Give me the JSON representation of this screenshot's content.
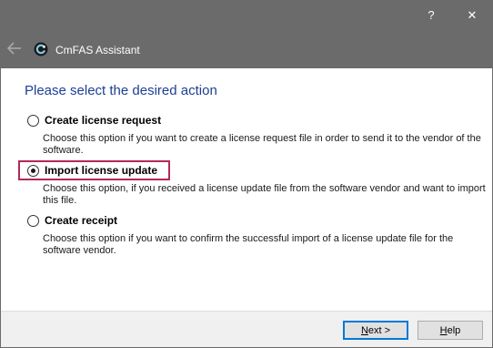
{
  "window": {
    "title": "CmFAS Assistant",
    "help_glyph": "?",
    "close_glyph": "✕"
  },
  "heading": "Please select the desired action",
  "options": [
    {
      "label": "Create license request",
      "selected": false,
      "description": "Choose this option if you want to create a license request file in order to send it to the vendor of the software."
    },
    {
      "label": "Import license update",
      "selected": true,
      "description": "Choose this option, if you received a license update file from the software vendor and want to import this file."
    },
    {
      "label": "Create receipt",
      "selected": false,
      "description": "Choose this option if you want to confirm the successful import of a license update file for the software vendor."
    }
  ],
  "buttons": {
    "next": {
      "mnemonic": "N",
      "rest": "ext >"
    },
    "help": {
      "mnemonic": "H",
      "rest": "elp"
    }
  },
  "colors": {
    "chrome": "#6b6b6b",
    "heading": "#1c3f94",
    "highlight": "#b22a55",
    "footer": "#f0f0f0"
  },
  "icons": [
    "back-arrow-icon",
    "cmfas-logo-icon",
    "help-icon",
    "close-icon",
    "radio-button-icon"
  ]
}
